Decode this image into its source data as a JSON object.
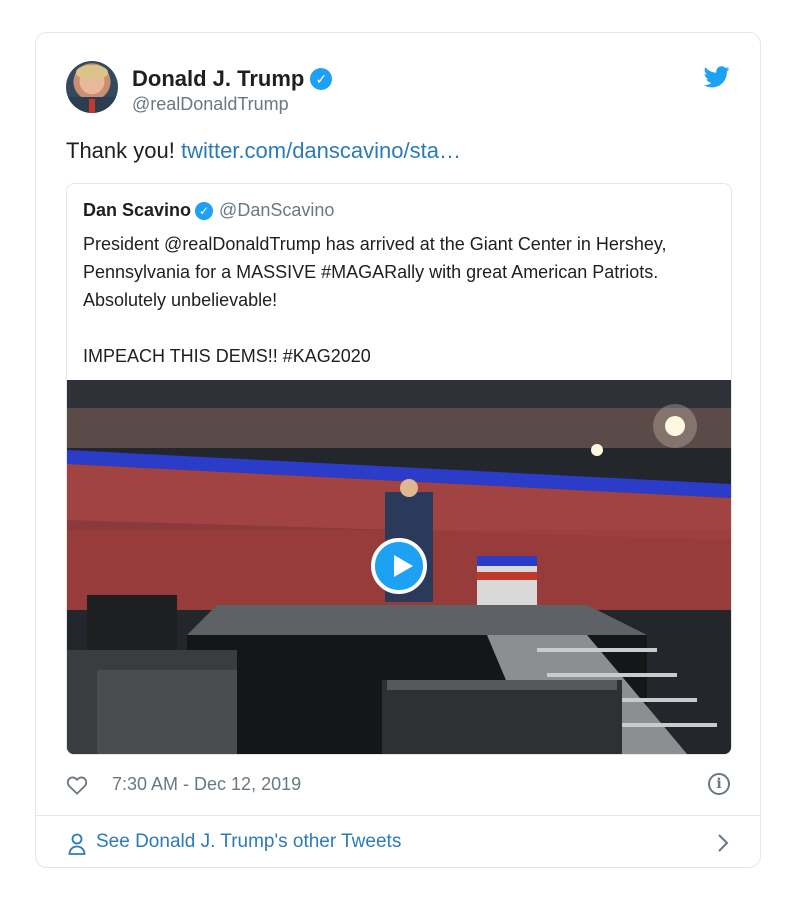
{
  "author": {
    "name": "Donald J. Trump",
    "handle": "@realDonaldTrump",
    "verified_glyph": "✓"
  },
  "tweet": {
    "text": "Thank you! ",
    "link_text": "twitter.com/danscavino/sta…"
  },
  "quoted": {
    "name": "Dan Scavino",
    "verified_glyph": "✓",
    "handle": "@DanScavino",
    "text_line_1": "President @realDonaldTrump has arrived at the Giant Center in Hershey, Pennsylvania for a MASSIVE #MAGARally with great American Patriots. Absolutely unbelievable!",
    "text_line_2": "IMPEACH THIS DEMS!! #KAG2020"
  },
  "meta": {
    "timestamp": "7:30 AM - Dec 12, 2019",
    "info_glyph": "i"
  },
  "footer": {
    "label": "See Donald J. Trump's other Tweets"
  },
  "icons": [
    "twitter-bird-icon",
    "verified-badge-icon",
    "play-icon",
    "heart-icon",
    "info-icon",
    "person-icon",
    "chevron-right-icon"
  ],
  "colors": {
    "brand": "#1da1f2",
    "link": "#2b7bb9",
    "secondary_text": "#697882",
    "text": "#1c2022",
    "border": "#e1e8ed"
  }
}
